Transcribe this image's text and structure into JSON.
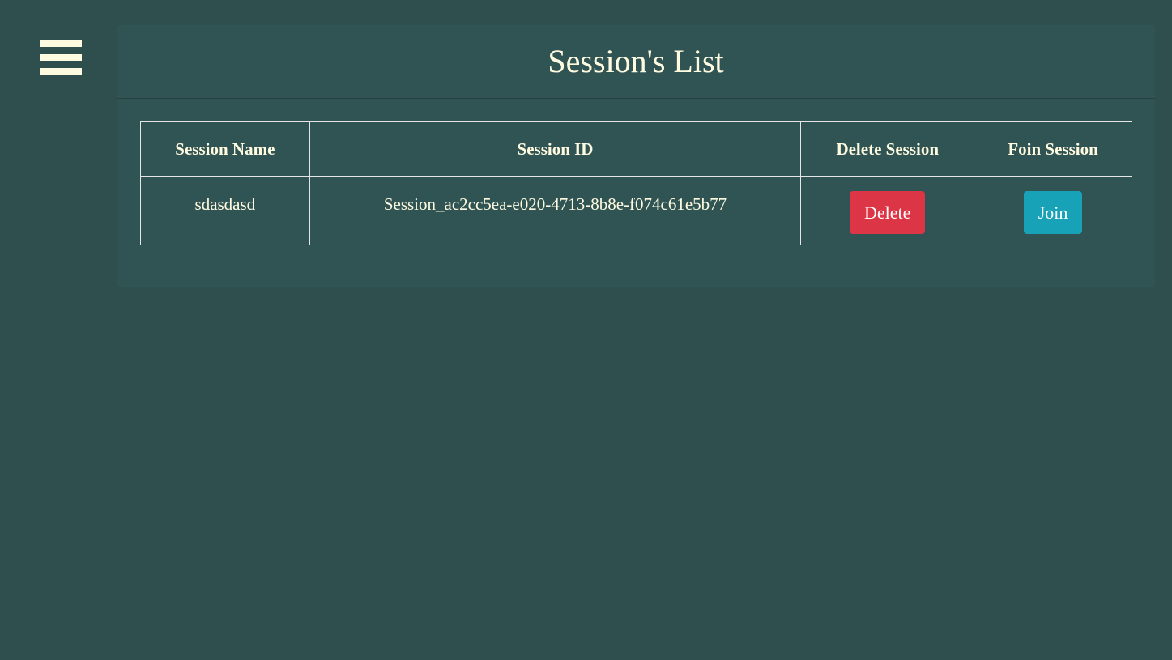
{
  "menu": {
    "icon": "hamburger-menu-icon"
  },
  "page": {
    "title": "Session's List"
  },
  "table": {
    "headers": [
      "Session Name",
      "Session ID",
      "Delete Session",
      "Foin Session"
    ],
    "rows": [
      {
        "name": "sdasdasd",
        "id": "Session_ac2cc5ea-e020-4713-8b8e-f074c61e5b77",
        "delete_label": "Delete",
        "join_label": "Join"
      }
    ]
  },
  "colors": {
    "background": "#2f4f4f",
    "card": "#305354",
    "text": "#fffbe0",
    "delete": "#dc3545",
    "join": "#17a2b8"
  }
}
